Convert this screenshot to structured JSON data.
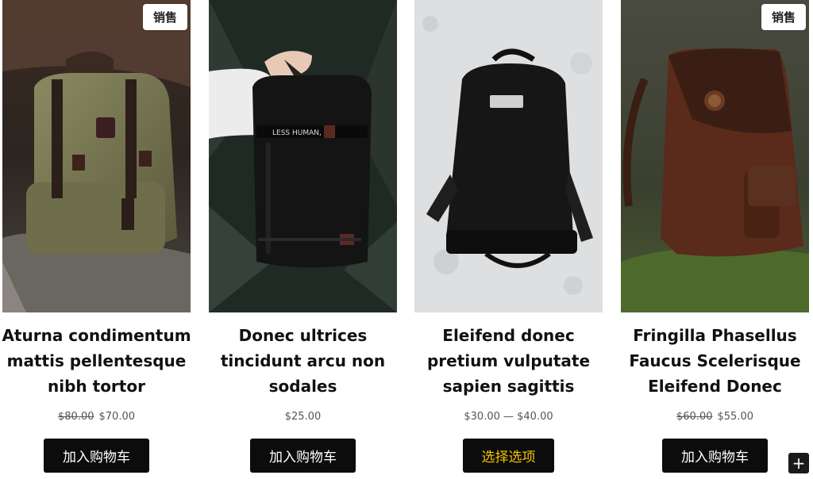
{
  "products": [
    {
      "badge": "销售",
      "title": "Aturna condimentum mattis pellentesque nibh tortor",
      "price_old": "$80.00",
      "price_new": "$70.00",
      "button": "加入购物车",
      "image": "olive-leather-backpack-on-rock"
    },
    {
      "title": "Donec ultrices tincidunt arcu non sodales",
      "price": "$25.00",
      "button": "加入购物车",
      "image": "hand-holding-black-backpack"
    },
    {
      "title": "Eleifend donec pretium vulputate sapien sagittis",
      "price_range": "$30.00 — $40.00",
      "button": "选择选项",
      "image": "black-backpack-on-snow"
    },
    {
      "badge": "销售",
      "title": "Fringilla Phasellus Faucus Scelerisque Eleifend Donec",
      "price_old": "$60.00",
      "price_new": "$55.00",
      "button": "加入购物车",
      "image": "brown-leather-backpack-on-grass"
    }
  ],
  "floating_button": "+",
  "colors": {
    "button_bg": "#0c0c0c",
    "button_text": "#ffffff",
    "options_text": "#f2c200"
  }
}
